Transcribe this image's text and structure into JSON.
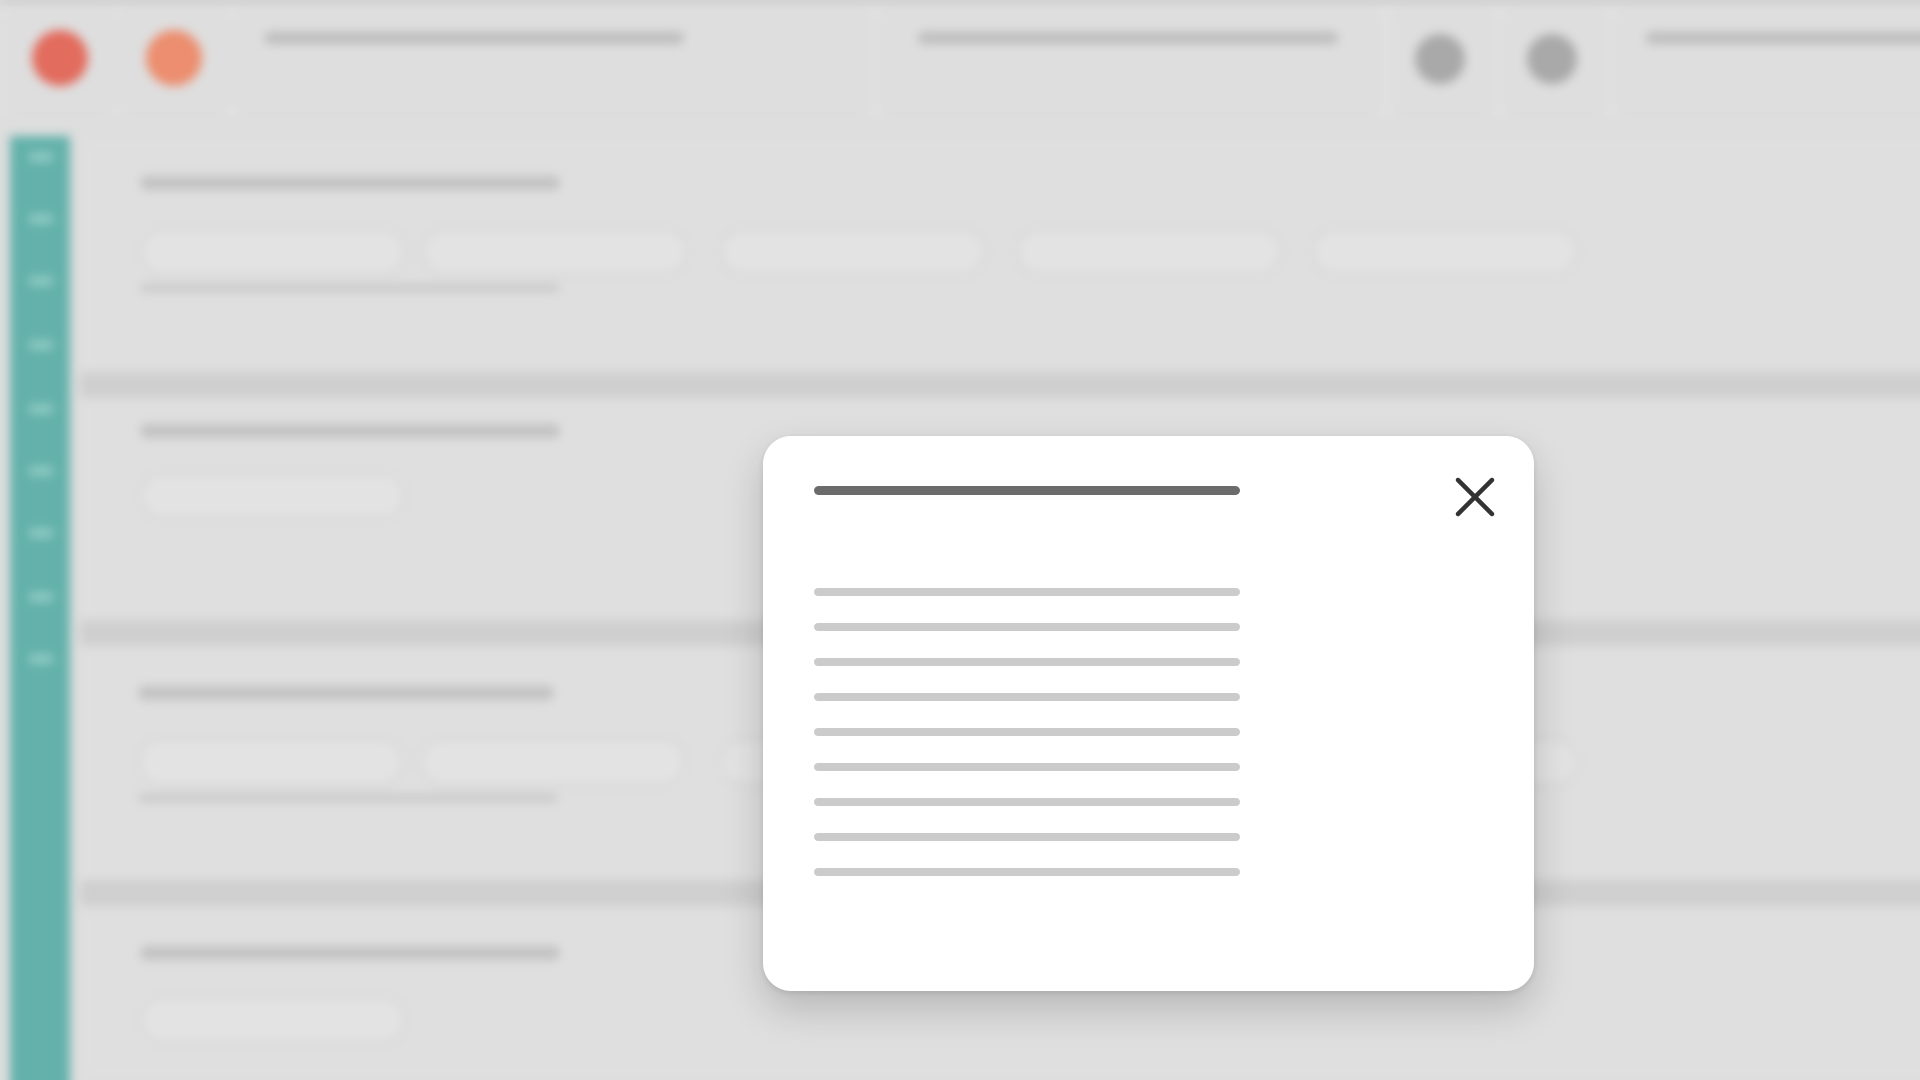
{
  "window": {
    "title": ""
  },
  "toolbar": {
    "traffic_lights": [
      {
        "name": "close",
        "color": "#e26c5e"
      },
      {
        "name": "minimize",
        "color": "#ec8e6f"
      }
    ],
    "action_icons": [
      "settings-icon",
      "profile-icon"
    ]
  },
  "sidebar": {
    "accent_color": "#63b1aa",
    "item_count": 9
  },
  "sections": [
    {
      "chips": 5
    },
    {
      "chips": 1
    },
    {
      "chips": 5
    },
    {
      "chips": 1
    }
  ],
  "modal": {
    "title": "",
    "body_lines": [
      "",
      "",
      "",
      "",
      "",
      "",
      "",
      "",
      ""
    ],
    "close_icon": "close-icon"
  },
  "colors": {
    "background": "#dedede",
    "sidebar": "#63b1aa",
    "modal_surface": "#ffffff",
    "title_placeholder": "#6b6b6b",
    "text_placeholder": "#cbcbcb"
  }
}
